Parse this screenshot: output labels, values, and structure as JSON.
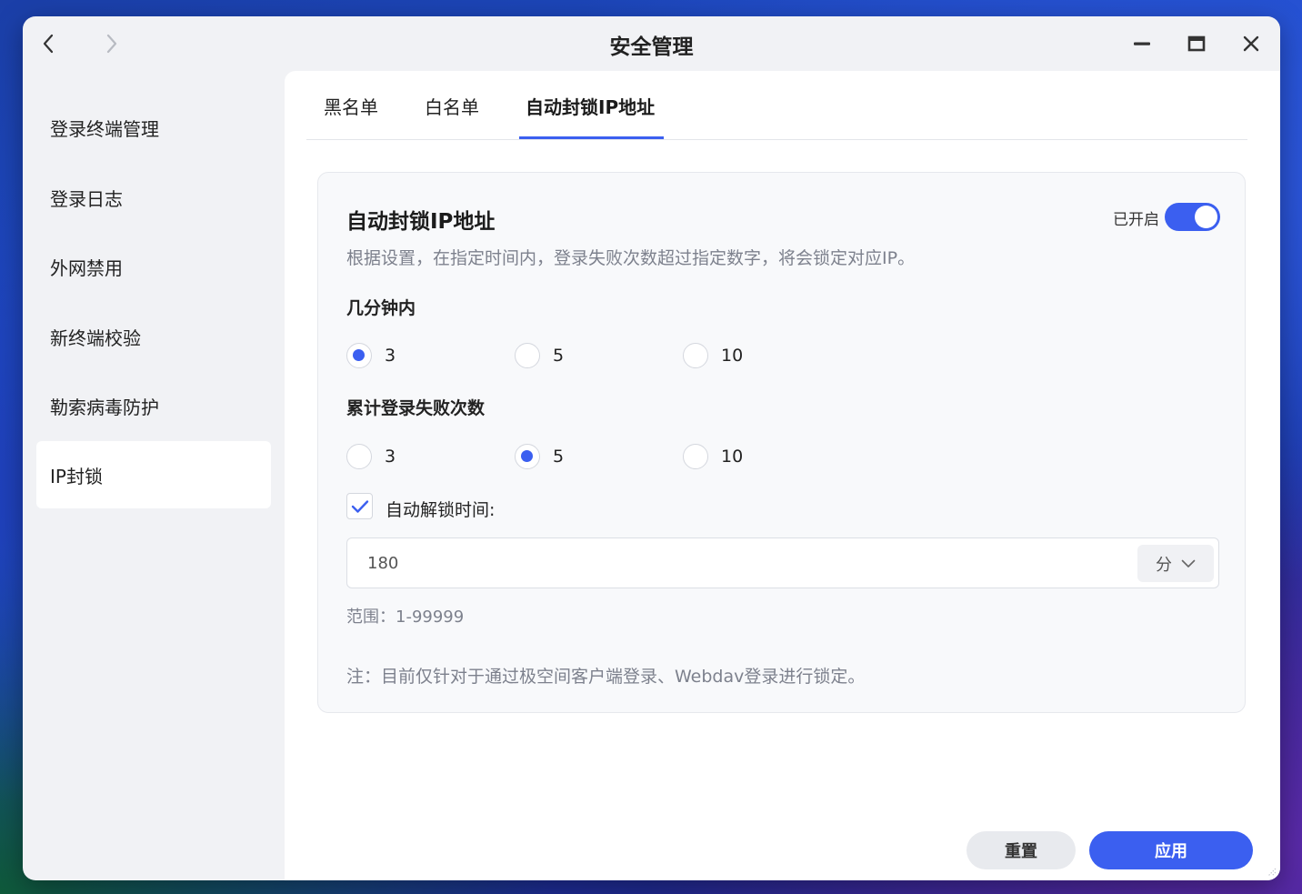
{
  "window": {
    "title": "安全管理",
    "nav_back_icon": "chevron-left-icon",
    "nav_forward_icon": "chevron-right-icon",
    "controls": [
      "minimize-icon",
      "maximize-icon",
      "close-icon"
    ]
  },
  "sidebar": {
    "items": [
      {
        "label": "登录终端管理",
        "active": false
      },
      {
        "label": "登录日志",
        "active": false
      },
      {
        "label": "外网禁用",
        "active": false
      },
      {
        "label": "新终端校验",
        "active": false
      },
      {
        "label": "勒索病毒防护",
        "active": false
      },
      {
        "label": "IP封锁",
        "active": true
      }
    ]
  },
  "tabs": [
    {
      "label": "黑名单",
      "active": false
    },
    {
      "label": "白名单",
      "active": false
    },
    {
      "label": "自动封锁IP地址",
      "active": true
    }
  ],
  "card": {
    "title": "自动封锁IP地址",
    "toggle_label": "已开启",
    "toggle_on": true,
    "description": "根据设置，在指定时间内，登录失败次数超过指定数字，将会锁定对应IP。",
    "minutes_section": {
      "label": "几分钟内",
      "options": [
        "3",
        "5",
        "10"
      ],
      "selected": "3"
    },
    "failures_section": {
      "label": "累计登录失败次数",
      "options": [
        "3",
        "5",
        "10"
      ],
      "selected": "5"
    },
    "auto_unlock": {
      "checked": true,
      "label": "自动解锁时间:",
      "value": "180",
      "unit": "分"
    },
    "range_text": "范围：1-99999",
    "note_text": "注：目前仅针对于通过极空间客户端登录、Webdav登录进行锁定。"
  },
  "buttons": {
    "reset": "重置",
    "apply": "应用"
  },
  "colors": {
    "accent": "#3b5ff0",
    "window_bg": "#f1f2f5",
    "card_bg": "#f8f9fb",
    "muted_text": "#7d818d"
  }
}
